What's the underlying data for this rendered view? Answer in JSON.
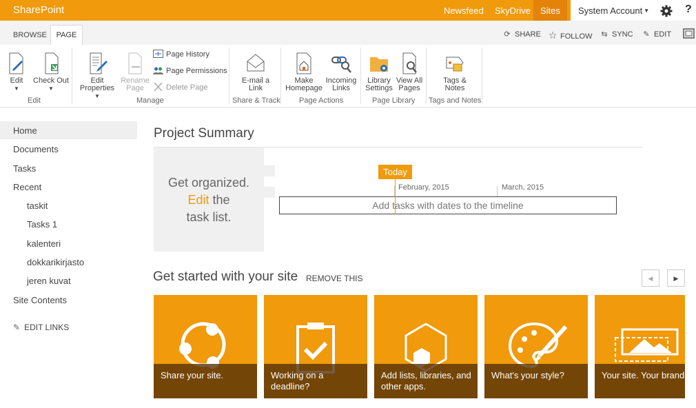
{
  "suite": {
    "brand": "SharePoint",
    "links": [
      "Newsfeed",
      "SkyDrive",
      "Sites"
    ],
    "account": "System Account",
    "help": "?"
  },
  "tabs": {
    "browse": "BROWSE",
    "page": "PAGE"
  },
  "actions": {
    "share": "SHARE",
    "follow": "FOLLOW",
    "sync": "SYNC",
    "edit": "EDIT"
  },
  "ribbon": {
    "edit_group": {
      "label": "Edit",
      "edit": "Edit",
      "check_out": "Check Out"
    },
    "manage_group": {
      "label": "Manage",
      "edit_properties": [
        "Edit",
        "Properties"
      ],
      "rename_page": [
        "Rename",
        "Page"
      ],
      "page_history": "Page History",
      "page_permissions": "Page Permissions",
      "delete_page": "Delete Page"
    },
    "share_group": {
      "label": "Share & Track",
      "email_link": [
        "E-mail a",
        "Link"
      ]
    },
    "actions_group": {
      "label": "Page Actions",
      "make_homepage": [
        "Make",
        "Homepage"
      ],
      "incoming_links": [
        "Incoming",
        "Links"
      ]
    },
    "library_group": {
      "label": "Page Library",
      "library_settings": [
        "Library",
        "Settings"
      ],
      "view_all_pages": [
        "View All",
        "Pages"
      ]
    },
    "tags_group": {
      "label": "Tags and Notes",
      "tags_notes": [
        "Tags &",
        "Notes"
      ]
    }
  },
  "nav": {
    "items": [
      "Home",
      "Documents",
      "Tasks",
      "Recent"
    ],
    "recent": [
      "taskit",
      "Tasks 1",
      "kalenteri",
      "dokkarikirjasto",
      "jeren kuvat"
    ],
    "site_contents": "Site Contents",
    "edit_links": "EDIT LINKS"
  },
  "summary": {
    "title": "Project Summary",
    "getorg_line1": "Get organized.",
    "getorg_edit": "Edit",
    "getorg_the": " the",
    "getorg_line3": "task list.",
    "today": "Today",
    "months": [
      "February, 2015",
      "March, 2015"
    ],
    "timeline_placeholder": "Add tasks with dates to the timeline"
  },
  "get_started": {
    "title": "Get started with your site",
    "remove": "REMOVE THIS",
    "tiles": [
      {
        "caption_1": "",
        "caption_2": "Share your site."
      },
      {
        "caption_1": "Working on a",
        "caption_2": "deadline?"
      },
      {
        "caption_1": "Add lists, libraries, and",
        "caption_2": "other apps."
      },
      {
        "caption_1": "",
        "caption_2": "What's your style?"
      },
      {
        "caption_1": "",
        "caption_2": "Your site. Your brand."
      }
    ]
  },
  "colors": {
    "accent": "#f09a0c",
    "tile_caption": "#502d05"
  }
}
